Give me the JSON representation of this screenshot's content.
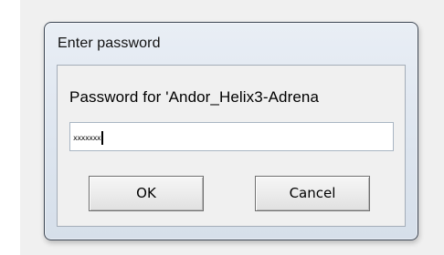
{
  "dialog": {
    "title": "Enter password",
    "prompt": "Password for 'Andor_Helix3-Adrena",
    "password_mask": "xxxxxxx",
    "ok_label": "OK",
    "cancel_label": "Cancel"
  }
}
